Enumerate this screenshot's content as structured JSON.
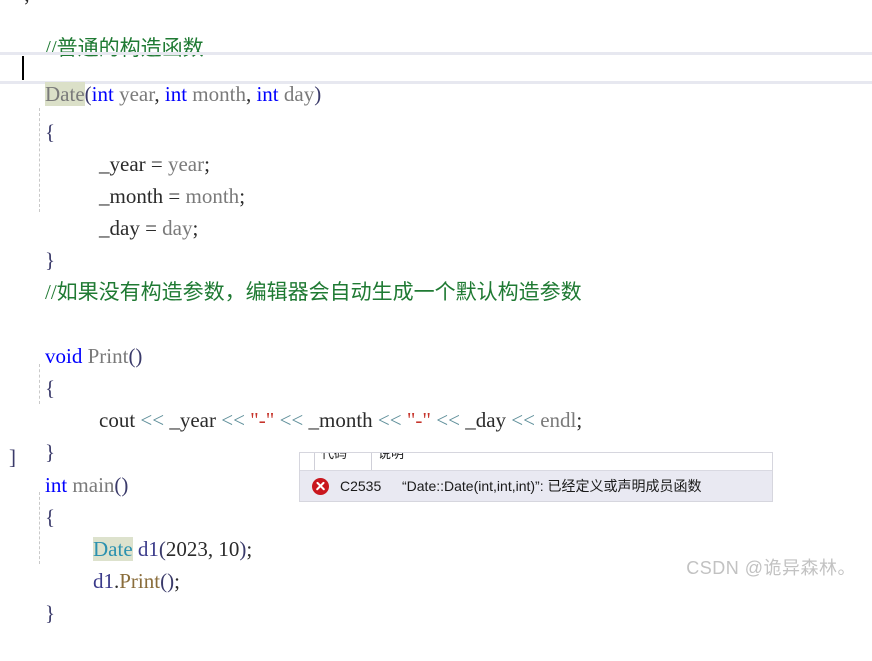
{
  "editor": {
    "language": "cpp",
    "top_fragment": ";",
    "lines": [
      {
        "id": "l1",
        "indent": 0,
        "text": "//普通的构造函数",
        "kind": "comment"
      },
      {
        "id": "l2",
        "indent": 0,
        "text": "Date(int year, int month, int day)",
        "kind": "signature",
        "current": true
      },
      {
        "id": "l3",
        "indent": 0,
        "text": "{",
        "kind": "brace"
      },
      {
        "id": "l4",
        "indent": 1,
        "text": "_year = year;",
        "kind": "stmt"
      },
      {
        "id": "l5",
        "indent": 1,
        "text": "_month = month;",
        "kind": "stmt"
      },
      {
        "id": "l6",
        "indent": 1,
        "text": "_day = day;",
        "kind": "stmt"
      },
      {
        "id": "l7",
        "indent": 0,
        "text": "}",
        "kind": "brace"
      },
      {
        "id": "l8",
        "indent": 0,
        "text": "//如果没有构造参数，编辑器会自动生成一个默认构造参数",
        "kind": "comment"
      },
      {
        "id": "l9",
        "indent": 0,
        "text": "",
        "kind": "blank"
      },
      {
        "id": "l10",
        "indent": 0,
        "text": "void Print()",
        "kind": "signature"
      },
      {
        "id": "l11",
        "indent": 0,
        "text": "{",
        "kind": "brace"
      },
      {
        "id": "l12",
        "indent": 1,
        "text": "cout << _year << \"-\" << _month << \"-\" << _day << endl;",
        "kind": "stmt"
      },
      {
        "id": "l13",
        "indent": 0,
        "text": "}",
        "kind": "brace"
      },
      {
        "id": "l14",
        "indent": 0,
        "text": "int main()",
        "kind": "signature",
        "fold_marker": "]"
      },
      {
        "id": "l15",
        "indent": 0,
        "text": "{",
        "kind": "brace"
      },
      {
        "id": "l16",
        "indent": 1,
        "text": "Date d1(2023, 10);",
        "kind": "stmt"
      },
      {
        "id": "l17",
        "indent": 1,
        "text": "d1.Print();",
        "kind": "stmt"
      },
      {
        "id": "l18",
        "indent": 0,
        "text": "}",
        "kind": "brace"
      }
    ],
    "tokens": {
      "comment_1": "//普通的构造函数",
      "comment_2": "//如果没有构造参数，编辑器会自动生成一个默认构造参数",
      "ctor_name": "Date",
      "kw_int": "int",
      "kw_void": "void",
      "param_year": "year",
      "param_month": "month",
      "param_day": "day",
      "field_year": "_year",
      "field_month": "_month",
      "field_day": "_day",
      "fn_print": "Print",
      "fn_main": "main",
      "id_cout": "cout",
      "id_endl": "endl",
      "op_shift": "<<",
      "str_dash": "\"-\"",
      "type_date": "Date",
      "var_d1": "d1",
      "num_2023": "2023",
      "num_10": "10"
    },
    "colors": {
      "comment": "#1f7a33",
      "keyword": "#0000ff",
      "identifier": "#7a7a7a",
      "type": "#2b91af",
      "string": "#c6342b",
      "operator": "#5f8f9a",
      "punctuation": "#3a3a6a",
      "reference_highlight": "#dbe0c8",
      "current_line_border": "#e7e8f0",
      "background": "#ffffff"
    }
  },
  "error_panel": {
    "columns": [
      "",
      "代码",
      "说明"
    ],
    "rows": [
      {
        "severity": "error",
        "severity_icon": "error-circle-x-icon",
        "code": "C2535",
        "description": "“Date::Date(int,int,int)”: 已经定义或声明成员函数"
      }
    ],
    "row_background": "#e9e9f2",
    "error_color": "#c9171e"
  },
  "watermark": {
    "text": "CSDN @诡异森林。",
    "color": "#c2c2c2"
  }
}
